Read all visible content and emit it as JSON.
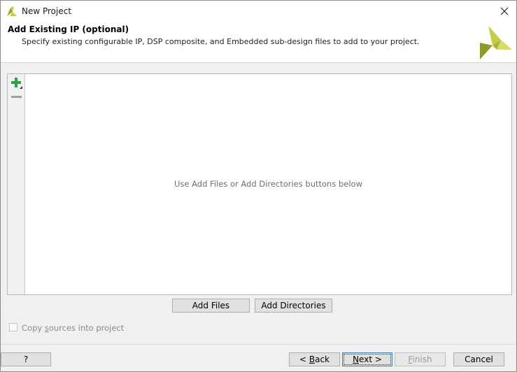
{
  "window": {
    "title": "New Project",
    "close_glyph": "✕"
  },
  "header": {
    "title": "Add Existing IP (optional)",
    "subtitle": "Specify existing configurable IP, DSP composite, and Embedded sub-design files to add to your project."
  },
  "table": {
    "empty_message": "Use Add Files or Add Directories buttons below"
  },
  "toolbar": {
    "add_icon": "plus-icon",
    "remove_icon": "minus-icon"
  },
  "actions": {
    "add_files": "Add Files",
    "add_directories": "Add Directories"
  },
  "copy_sources": {
    "label_pre": "Copy ",
    "label_mnemonic": "s",
    "label_post": "ources into project",
    "checked": false
  },
  "footer": {
    "help": "?",
    "back_glyph": "<",
    "back_mnemonic": "B",
    "back_rest": "ack",
    "next_mnemonic": "N",
    "next_rest": "ext",
    "next_glyph": ">",
    "finish_mnemonic": "F",
    "finish_rest": "inish",
    "cancel": "Cancel"
  },
  "colors": {
    "logo_light": "#c7cc44",
    "logo_dark": "#8f9a2a",
    "plus_green": "#2ea043",
    "minus_gray": "#a0a0a0"
  }
}
